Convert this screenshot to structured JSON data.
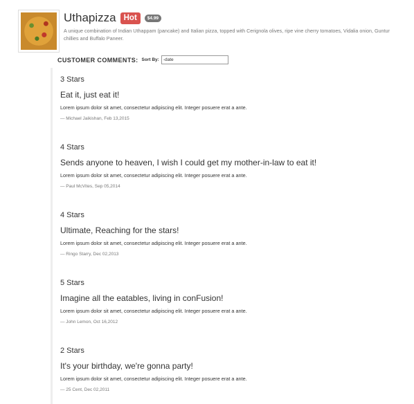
{
  "dish": {
    "name": "Uthapizza",
    "label": "Hot",
    "price": "$4.99",
    "description": "A unique combination of Indian Uthappam (pancake) and Italian pizza, topped with Cerignola olives, ripe vine cherry tomatoes, Vidalia onion, Guntur chillies and Buffalo Paneer.",
    "image_icon": "pizza-image"
  },
  "comments_section": {
    "title": "CUSTOMER COMMENTS:",
    "sort_label": "Sort By:",
    "sort_value": "-date"
  },
  "comments": [
    {
      "rating": "3 Stars",
      "headline": "Eat it, just eat it!",
      "body": "Lorem ipsum dolor sit amet, consectetur adipiscing elit. Integer posuere erat a ante.",
      "footer": "— Michael Jaikishan, Feb 13,2015"
    },
    {
      "rating": "4 Stars",
      "headline": "Sends anyone to heaven, I wish I could get my mother-in-law to eat it!",
      "body": "Lorem ipsum dolor sit amet, consectetur adipiscing elit. Integer posuere erat a ante.",
      "footer": "— Paul McVites, Sep 05,2014"
    },
    {
      "rating": "4 Stars",
      "headline": "Ultimate, Reaching for the stars!",
      "body": "Lorem ipsum dolor sit amet, consectetur adipiscing elit. Integer posuere erat a ante.",
      "footer": "— Ringo Starry, Dec 02,2013"
    },
    {
      "rating": "5 Stars",
      "headline": "Imagine all the eatables, living in conFusion!",
      "body": "Lorem ipsum dolor sit amet, consectetur adipiscing elit. Integer posuere erat a ante.",
      "footer": "— John Lemon, Oct 16,2012"
    },
    {
      "rating": "2 Stars",
      "headline": "It's your birthday, we're gonna party!",
      "body": "Lorem ipsum dolor sit amet, consectetur adipiscing elit. Integer posuere erat a ante.",
      "footer": "— 25 Cent, Dec 02,2011"
    }
  ]
}
